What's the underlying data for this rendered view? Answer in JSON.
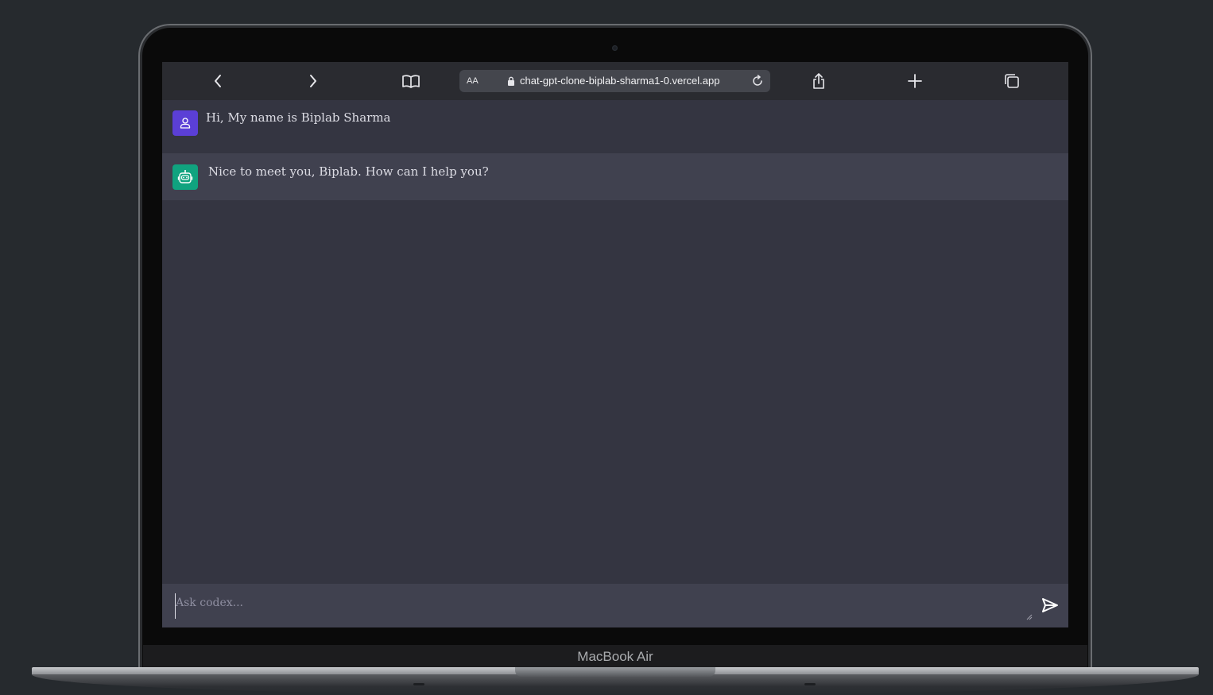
{
  "device": {
    "brand_label": "MacBook Air"
  },
  "browser": {
    "reader_label": "AA",
    "url": "chat-gpt-clone-biplab-sharma1-0.vercel.app",
    "icons": [
      "back-icon",
      "forward-icon",
      "book-icon",
      "lock-icon",
      "reload-icon",
      "share-icon",
      "plus-icon",
      "tabs-icon"
    ]
  },
  "chat": {
    "messages": [
      {
        "role": "user",
        "avatar_icon": "user-icon",
        "text": "Hi, My name is Biplab Sharma"
      },
      {
        "role": "assistant",
        "avatar_icon": "bot-icon",
        "text": "Nice to meet you, Biplab. How can I help you?"
      }
    ],
    "input": {
      "value": "",
      "placeholder": "Ask codex..."
    },
    "send_icon": "send-icon"
  },
  "colors": {
    "user_avatar": "#5b3fd6",
    "bot_avatar": "#10a37f",
    "chat_bg": "#343541",
    "bot_row_bg": "#40414f"
  }
}
